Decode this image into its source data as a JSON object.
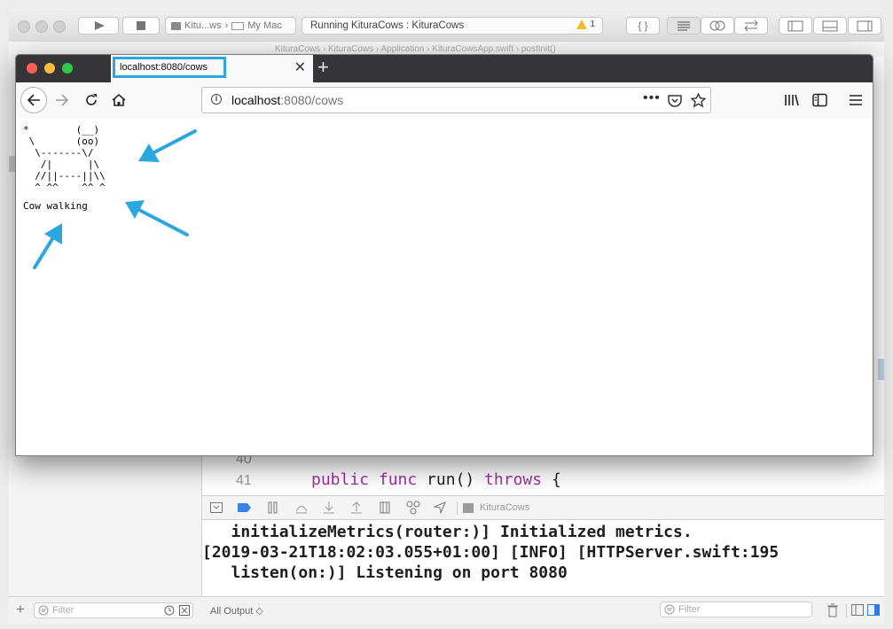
{
  "xcode": {
    "scheme": "Kitu...ws",
    "destination": "My Mac",
    "activity": "Running KituraCows : KituraCows",
    "warning_count": "1",
    "breadcrumb": "KituraCows  ›  KituraCows  ›  Application  ›  KituraCowsApp.swift  ›  postInit()",
    "editor": {
      "lines": [
        {
          "num": "40",
          "code": ""
        },
        {
          "num": "41",
          "indent": "    ",
          "kw1": "public func",
          "mid": " run() ",
          "kw2": "throws",
          "end": " {"
        }
      ]
    },
    "debug_target": "KituraCows",
    "console": [
      "   initializeMetrics(router:)] Initialized metrics.",
      "[2019-03-21T18:02:03.055+01:00] [INFO] [HTTPServer.swift:195",
      "   listen(on:)] Listening on port 8080"
    ],
    "nav_filter_placeholder": "Filter",
    "output_selector": "All Output ◇",
    "console_filter_placeholder": "Filter"
  },
  "browser": {
    "tab_title": "localhost:8080/cows",
    "url_host": "localhost",
    "url_path": ":8080/cows",
    "cow_ascii": "*        (__)\n \\       (oo)\n  \\-------\\/\n   /|      |\\\n  //||----||\\\\\n  ^ ^^    ^^ ^",
    "cow_caption": "Cow walking"
  },
  "annotation_color": "#2ba7df"
}
